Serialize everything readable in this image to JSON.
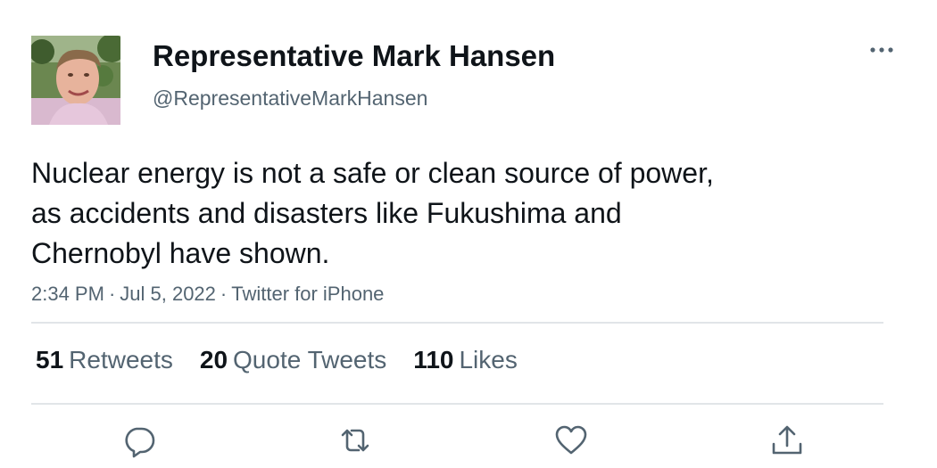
{
  "tweet": {
    "author": {
      "display_name": "Representative Mark Hansen",
      "handle": "@RepresentativeMarkHansen",
      "avatar_icon": "profile-photo"
    },
    "text": "Nuclear energy is not a safe or clean source of power,\nas accidents and disasters like Fukushima and\nChernobyl have shown.",
    "time": "2:34 PM",
    "date": "Jul 5, 2022",
    "separator": "·",
    "source": "Twitter for iPhone",
    "more_icon": "more-horizontal-icon"
  },
  "stats": {
    "retweets": {
      "count": "51",
      "label": "Retweets"
    },
    "quote_tweets": {
      "count": "20",
      "label": "Quote Tweets"
    },
    "likes": {
      "count": "110",
      "label": "Likes"
    }
  },
  "actions": [
    {
      "name": "reply",
      "icon": "reply-icon"
    },
    {
      "name": "retweet",
      "icon": "retweet-icon"
    },
    {
      "name": "like",
      "icon": "heart-icon"
    },
    {
      "name": "share",
      "icon": "share-icon"
    }
  ],
  "colors": {
    "text_primary": "#0f1419",
    "text_secondary": "#536471",
    "divider": "#e1e5e8",
    "icon": "#536471"
  }
}
